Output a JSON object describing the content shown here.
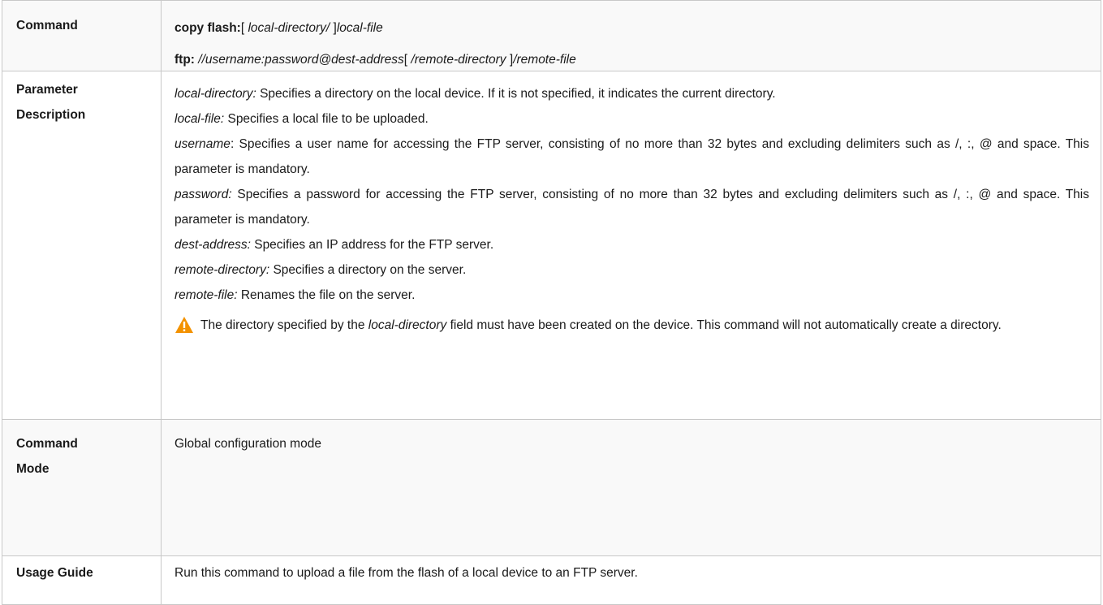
{
  "rows": {
    "command": {
      "label": "Command",
      "line1": {
        "kw": "copy flash:",
        "open": "[ ",
        "arg1": "local-directory/",
        "close": " ]",
        "arg2": "local-file"
      },
      "line2": {
        "kw": "ftp:",
        "arg1": " //username:password@dest-address",
        "open": "[ ",
        "arg2": "/remote-directory",
        "close": " ]",
        "arg3": "/remote-file"
      }
    },
    "parameter_description": {
      "label_line1": "Parameter",
      "label_line2": "Description",
      "params": [
        {
          "name": "local-directory:",
          "desc": " Specifies a directory on the local device. If it is not specified, it indicates the current directory."
        },
        {
          "name": "local-file:",
          "desc": " Specifies a local file to be uploaded."
        },
        {
          "name": "username",
          "desc": ": Specifies a user name for accessing the FTP server, consisting of no more than 32 bytes and excluding delimiters such as /, :, @ and space. This parameter is mandatory."
        },
        {
          "name": "password:",
          "desc": " Specifies a password for accessing the FTP server, consisting of no more than 32 bytes and excluding delimiters such as /, :, @ and space. This parameter is mandatory."
        },
        {
          "name": "dest-address:",
          "desc": " Specifies an IP address for the FTP server."
        },
        {
          "name": "remote-directory:",
          "desc": " Specifies a directory on the server."
        },
        {
          "name": "remote-file:",
          "desc": " Renames the file on the server."
        }
      ],
      "warning": {
        "icon": "warning-triangle-icon",
        "before": "The directory specified by the ",
        "field": "local-directory",
        "after": " field must have been created on the device. This command will not automatically create a directory.",
        "icon_color": "#f39200"
      }
    },
    "command_mode": {
      "label_line1": "Command",
      "label_line2": "Mode",
      "value": "Global configuration mode"
    },
    "usage_guide": {
      "label": "Usage Guide",
      "value": "Run this command to upload a file from the flash of a local device to an FTP server."
    }
  }
}
